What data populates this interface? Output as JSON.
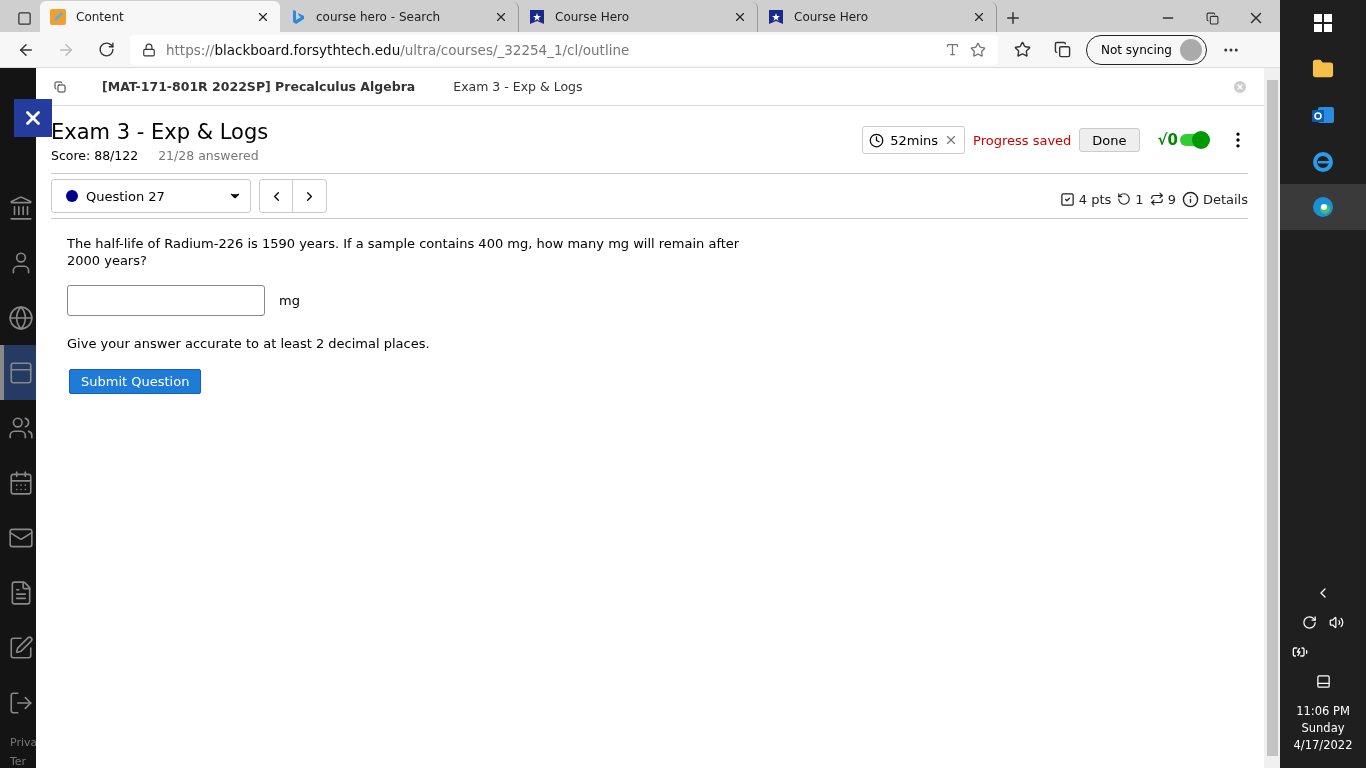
{
  "browser": {
    "tabs": [
      {
        "title": "Content",
        "kind": "pencil",
        "selected": true
      },
      {
        "title": "course hero - Search",
        "kind": "bing",
        "selected": false
      },
      {
        "title": "Course Hero",
        "kind": "star",
        "selected": false
      },
      {
        "title": "Course Hero",
        "kind": "star",
        "selected": false
      }
    ],
    "address": {
      "scheme": "https://",
      "host": "blackboard.forsythtech.edu",
      "path": "/ultra/courses/_32254_1/cl/outline"
    },
    "profile": "Not syncing"
  },
  "sidebar": {
    "items": [
      {
        "kind": "institution",
        "selected": false
      },
      {
        "kind": "person",
        "selected": false
      },
      {
        "kind": "globe",
        "selected": false
      },
      {
        "kind": "courses",
        "selected": true
      },
      {
        "kind": "groups",
        "selected": false
      },
      {
        "kind": "calendar",
        "selected": false
      },
      {
        "kind": "mail",
        "selected": false
      },
      {
        "kind": "grades",
        "selected": false
      },
      {
        "kind": "edit",
        "selected": false
      },
      {
        "kind": "signout",
        "selected": false
      }
    ],
    "footer": [
      "Priva",
      "Ter"
    ]
  },
  "breadcrumb": {
    "course": "[MAT-171-801R 2022SP] Precalculus Algebra",
    "page": "Exam 3 - Exp & Logs"
  },
  "exam": {
    "title": "Exam 3 - Exp & Logs",
    "score": "Score: 88/122",
    "answered": "21/28 answered",
    "timer": "52mins",
    "status": "Progress saved",
    "done": "Done",
    "math_toggle": {
      "label": "√0",
      "on": true
    }
  },
  "question": {
    "selector": "Question 27",
    "points": "4 pts",
    "retries": "1",
    "attempts": "9",
    "details": "Details",
    "text": "The half-life of Radium-226 is 1590 years. If a sample contains 400 mg, how many mg will remain after 2000 years?",
    "unit": "mg",
    "hint": "Give your answer accurate to at least 2 decimal places.",
    "submit": "Submit Question"
  },
  "taskbar": {
    "time": "11:06 PM",
    "day": "Sunday",
    "date": "4/17/2022"
  }
}
